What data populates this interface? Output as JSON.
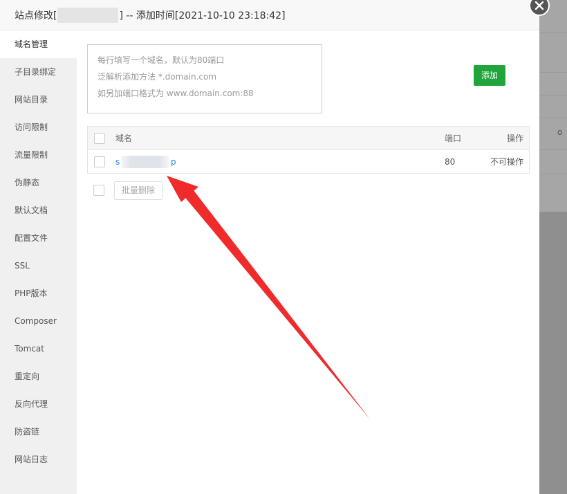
{
  "modal": {
    "title_prefix": "站点修改[",
    "title_suffix": "] -- 添加时间[2021-10-10 23:18:42]"
  },
  "sidebar": {
    "items": [
      {
        "label": "域名管理",
        "active": true
      },
      {
        "label": "子目录绑定"
      },
      {
        "label": "网站目录"
      },
      {
        "label": "访问限制"
      },
      {
        "label": "流量限制"
      },
      {
        "label": "伪静态"
      },
      {
        "label": "默认文档"
      },
      {
        "label": "配置文件"
      },
      {
        "label": "SSL"
      },
      {
        "label": "PHP版本"
      },
      {
        "label": "Composer"
      },
      {
        "label": "Tomcat"
      },
      {
        "label": "重定向"
      },
      {
        "label": "反向代理"
      },
      {
        "label": "防盗链"
      },
      {
        "label": "网站日志"
      }
    ]
  },
  "domain_input": {
    "placeholder_lines": [
      "每行填写一个域名，默认为80端口",
      "泛解析添加方法 *.domain.com",
      "如另加端口格式为 www.domain.com:88"
    ]
  },
  "add_button": {
    "label": "添加"
  },
  "table": {
    "headers": {
      "name": "域名",
      "port": "端口",
      "op": "操作"
    },
    "rows": [
      {
        "domain_start": "s",
        "domain_end": "p",
        "port": "80",
        "op": "不可操作"
      }
    ]
  },
  "batch_delete": {
    "label": "批量删除"
  },
  "colors": {
    "accent": "#20a53a",
    "annotation_arrow": "#f02b2b"
  },
  "icons": [
    "close-icon",
    "checkbox-icon"
  ],
  "backdrop": {
    "glyph": "o"
  }
}
